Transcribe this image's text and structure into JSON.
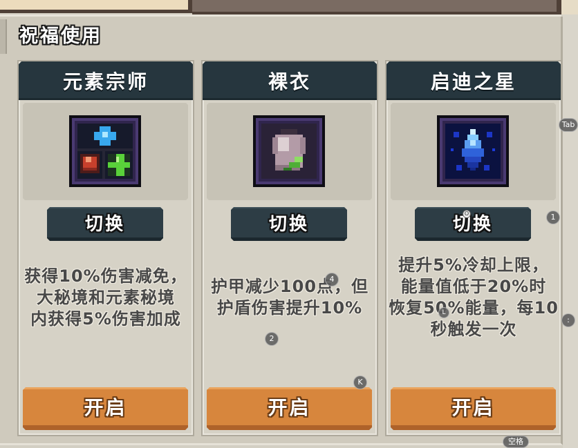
{
  "panel": {
    "title": "祝福使用"
  },
  "blessings": [
    {
      "name": "元素宗师",
      "icon": "elemental-gems-icon",
      "switch_label": "切换",
      "description": [
        "获得10%伤害减免，",
        "大秘境和元素秘境",
        "内获得5%伤害加成"
      ],
      "activate_label": "开启"
    },
    {
      "name": "裸衣",
      "icon": "bare-robe-icon",
      "switch_label": "切换",
      "description": [
        "护甲减少100点，但",
        "护盾伤害提升10%"
      ],
      "activate_label": "开启"
    },
    {
      "name": "启迪之星",
      "icon": "enlightenment-crystal-icon",
      "switch_label": "切换",
      "description": [
        "提升5%冷却上限，",
        "能量值低于20%时",
        "恢复50%能量，每10",
        "秒触发一次"
      ],
      "activate_label": "开启"
    }
  ],
  "hotkey_hints": {
    "tab": "Tab",
    "key_1": "1",
    "key_o": "O",
    "key_4": "4",
    "key_2": "2",
    "key_k": "K",
    "key_l": "L",
    "key_colon": ":",
    "space": "空格"
  },
  "colors": {
    "card_header": "#26363e",
    "switch_button": "#2d3d45",
    "activate_button": "#d7863d",
    "panel_background": "#cfcabd",
    "description_text": "#484848"
  }
}
